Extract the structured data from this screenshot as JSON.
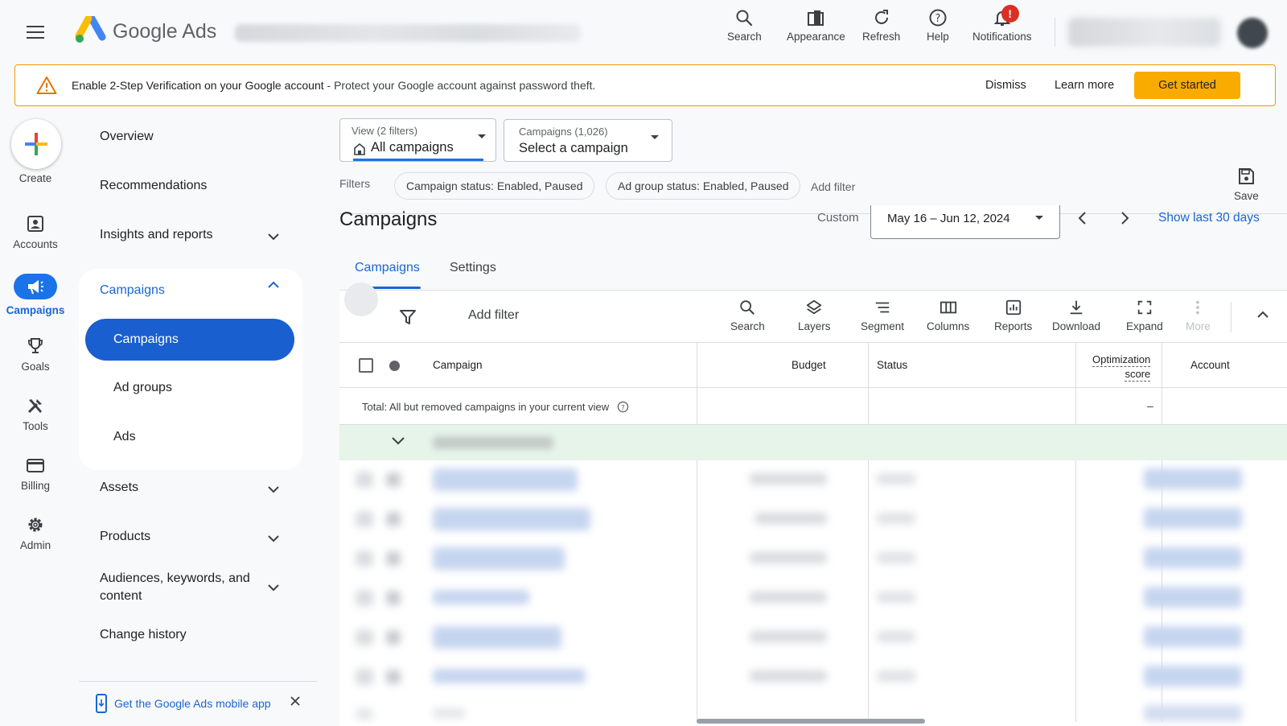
{
  "topbar": {
    "brand_google": "Google",
    "brand_ads": "Ads",
    "tools": [
      {
        "label": "Search",
        "icon": "search-icon"
      },
      {
        "label": "Appearance",
        "icon": "appearance-icon"
      },
      {
        "label": "Refresh",
        "icon": "refresh-icon"
      },
      {
        "label": "Help",
        "icon": "help-icon"
      },
      {
        "label": "Notifications",
        "icon": "bell-icon"
      }
    ],
    "notification_badge": "!"
  },
  "banner": {
    "title": "Enable 2-Step Verification on your Google account",
    "description": " - Protect your Google account against password theft.",
    "dismiss": "Dismiss",
    "learn_more": "Learn more",
    "get_started": "Get started"
  },
  "rail": {
    "create": "Create",
    "items": [
      "Accounts",
      "Campaigns",
      "Goals",
      "Tools",
      "Billing",
      "Admin"
    ],
    "active": "Campaigns"
  },
  "nav": {
    "overview": "Overview",
    "recommendations": "Recommendations",
    "insights": "Insights and reports",
    "campaigns_header": "Campaigns",
    "campaigns_sub": [
      "Campaigns",
      "Ad groups",
      "Ads"
    ],
    "assets": "Assets",
    "products": "Products",
    "audiences_line1": "Audiences, keywords, and",
    "audiences_line2": "content",
    "change_history": "Change history",
    "mobile_app": "Get the Google Ads mobile app"
  },
  "filters": {
    "view_label": "View (2 filters)",
    "view_value": "All campaigns",
    "campaigns_label": "Campaigns (1,026)",
    "campaigns_value": "Select a campaign",
    "filters_label": "Filters",
    "chips": [
      "Campaign status: Enabled, Paused",
      "Ad group status: Enabled, Paused"
    ],
    "add_filter": "Add filter",
    "save": "Save"
  },
  "main": {
    "title": "Campaigns",
    "custom": "Custom",
    "date_range": "May 16 – Jun 12, 2024",
    "show_last": "Show last 30 days",
    "tabs": [
      "Campaigns",
      "Settings"
    ]
  },
  "table": {
    "add_filter": "Add filter",
    "tools": [
      "Search",
      "Layers",
      "Segment",
      "Columns",
      "Reports",
      "Download",
      "Expand",
      "More"
    ],
    "headers": {
      "campaign": "Campaign",
      "budget": "Budget",
      "status": "Status",
      "opt_line1": "Optimization",
      "opt_line2": "score",
      "account": "Account"
    },
    "total": "Total: All but removed campaigns in your current view",
    "total_opt": "–"
  },
  "colors": {
    "accent": "#1a73e8",
    "warning": "#f9ab00",
    "badge": "#d93025",
    "group_row": "#e6f4ea"
  }
}
